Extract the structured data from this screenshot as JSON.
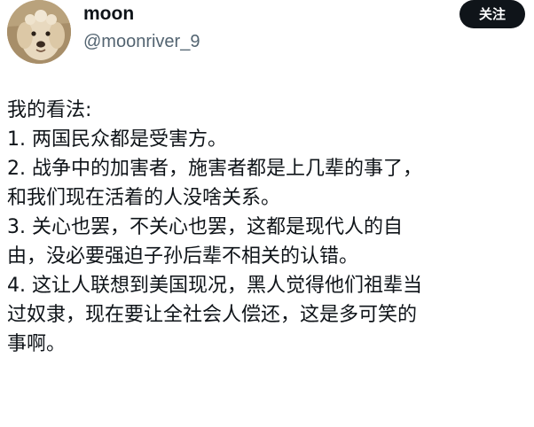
{
  "author": {
    "display_name": "moon",
    "handle": "@moonriver_9",
    "avatar_icon": "dog-avatar-icon"
  },
  "follow_button": {
    "label": "关注"
  },
  "post": {
    "lines": [
      "我的看法:",
      "1. 两国民众都是受害方。",
      "2. 战争中的加害者，施害者都是上几辈的事了，",
      "和我们现在活着的人没啥关系。",
      "3. 关心也罢，不关心也罢，这都是现代人的自",
      "由，没必要强迫子孙后辈不相关的认错。",
      "4. 这让人联想到美国现况，黑人觉得他们祖辈当",
      "过奴隶，现在要让全社会人偿还，这是多可笑的",
      "事啊。"
    ]
  },
  "colors": {
    "text_primary": "#0f1419",
    "text_secondary": "#536471",
    "button_bg": "#0f1419",
    "button_text": "#ffffff"
  }
}
